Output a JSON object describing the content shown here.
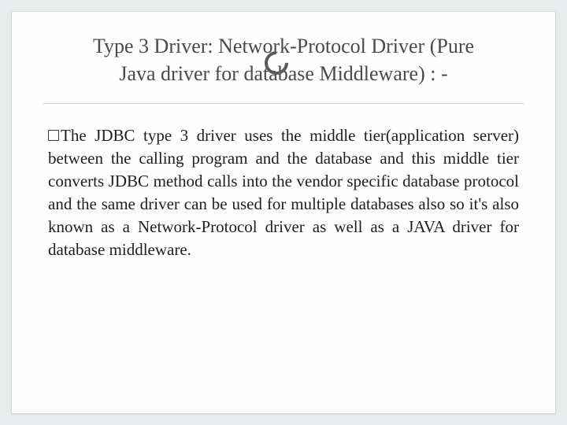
{
  "slide": {
    "title_line1": "Type 3 Driver: Network-Protocol Driver (Pure",
    "title_line2": "Java driver for database Middleware) : -",
    "body": "The JDBC type 3 driver uses the middle tier(application server) between the calling program and the database and this middle tier converts JDBC method calls into the vendor specific database protocol and the same driver can be used for multiple databases also so it's also known as a Network-Protocol driver as well as a JAVA driver for database middleware."
  }
}
